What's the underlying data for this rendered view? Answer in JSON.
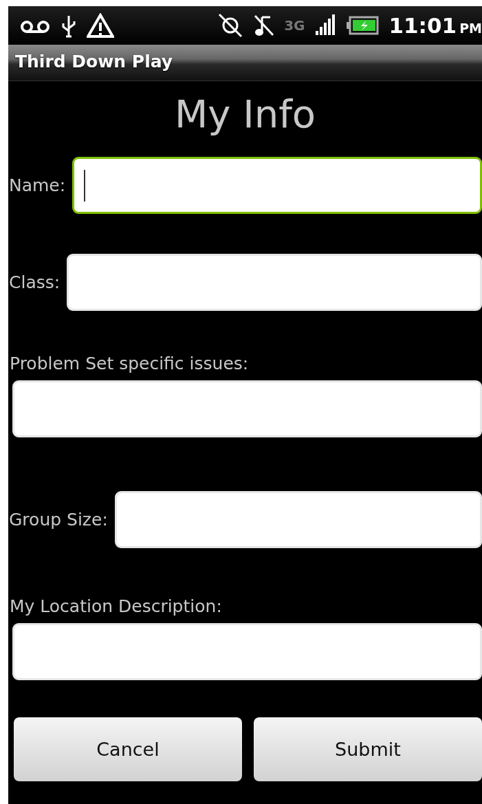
{
  "status_bar": {
    "network": "3G",
    "time": "11:01",
    "meridiem": "PM"
  },
  "title_bar": {
    "title": "Third Down Play"
  },
  "heading": "My Info",
  "fields": [
    {
      "kind": "inline",
      "label": "Name:",
      "focused": true
    },
    {
      "kind": "inline",
      "label": "Class:",
      "focused": false
    },
    {
      "kind": "stacked",
      "label": "Problem Set specific issues:",
      "focused": false
    },
    {
      "kind": "inline",
      "label": "Group Size:",
      "focused": false
    },
    {
      "kind": "stacked",
      "label": "My Location Description:",
      "focused": false
    }
  ],
  "buttons": [
    "Cancel",
    "Submit"
  ]
}
